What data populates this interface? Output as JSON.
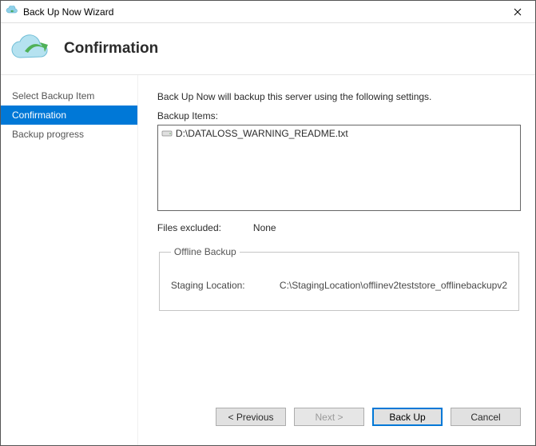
{
  "window": {
    "title": "Back Up Now Wizard"
  },
  "header": {
    "heading": "Confirmation"
  },
  "sidebar": {
    "items": [
      {
        "label": "Select Backup Item"
      },
      {
        "label": "Confirmation"
      },
      {
        "label": "Backup progress"
      }
    ]
  },
  "main": {
    "intro": "Back Up Now will backup this server using the following settings.",
    "backup_items_label": "Backup Items:",
    "backup_items": [
      "D:\\DATALOSS_WARNING_README.txt"
    ],
    "files_excluded_label": "Files excluded:",
    "files_excluded_value": "None",
    "offline": {
      "legend": "Offline Backup",
      "staging_label": "Staging Location:",
      "staging_value": "C:\\StagingLocation\\offlinev2teststore_offlinebackupv2"
    }
  },
  "buttons": {
    "previous": "< Previous",
    "next": "Next >",
    "backup": "Back Up",
    "cancel": "Cancel"
  }
}
